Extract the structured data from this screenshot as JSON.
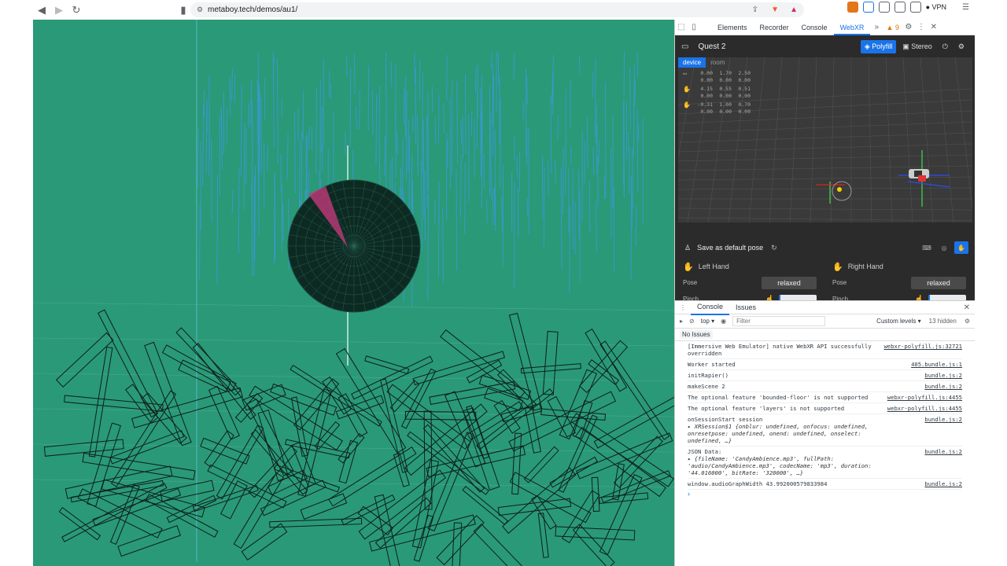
{
  "browser": {
    "url": "metaboy.tech/demos/au1/",
    "vpn_label": "VPN"
  },
  "devtools": {
    "tabs": [
      "Elements",
      "Recorder",
      "Console",
      "WebXR"
    ],
    "active_tab": "WebXR",
    "warning_count": "9"
  },
  "webxr": {
    "device": "Quest 2",
    "polyfill_label": "Polyfill",
    "stereo_label": "Stereo",
    "scene_tabs": [
      "device",
      "room"
    ],
    "poses": [
      {
        "icon": "headset-icon",
        "row1": [
          "0.00",
          "1.70",
          "2.50"
        ],
        "row2": [
          "0.00",
          "0.00",
          "0.00"
        ]
      },
      {
        "icon": "left-hand-icon",
        "row1": [
          "4.15",
          "0.55",
          "0.51"
        ],
        "row2": [
          "0.00",
          "0.00",
          "0.00"
        ]
      },
      {
        "icon": "right-hand-icon",
        "row1": [
          "-0.31",
          "1.00",
          "0.70"
        ],
        "row2": [
          "0.00",
          "0.00",
          "0.00"
        ]
      }
    ],
    "save_pose_label": "Save as default pose",
    "left_hand": {
      "title": "Left Hand",
      "pose_label": "Pose",
      "pose_value": "relaxed",
      "pinch_label": "Pinch",
      "pinch_level": 0.05
    },
    "right_hand": {
      "title": "Right Hand",
      "pose_label": "Pose",
      "pose_value": "relaxed",
      "pinch_label": "Pinch",
      "pinch_level": 0.05
    }
  },
  "console": {
    "tabs": [
      "Console",
      "Issues"
    ],
    "context": "top",
    "filter_placeholder": "Filter",
    "levels": "Custom levels",
    "hidden": "13 hidden",
    "no_issues": "No Issues",
    "entries": [
      {
        "msg": "[Immersive Web Emulator] native WebXR API successfully overridden",
        "src": "webxr-polyfill.js:32721"
      },
      {
        "msg": "Worker started",
        "src": "405.bundle.js:1"
      },
      {
        "msg": "initRapier()",
        "src": "bundle.js:2"
      },
      {
        "msg": "makeScene 2",
        "src": "bundle.js:2"
      },
      {
        "msg": "The optional feature 'bounded-floor' is not supported",
        "src": "webxr-polyfill.js:4455"
      },
      {
        "msg": "The optional feature 'layers' is not supported",
        "src": "webxr-polyfill.js:4455"
      },
      {
        "msg": "onSessionStart session",
        "src": "bundle.js:2",
        "obj": "▸ XRSession$1 {onblur: undefined, onfocus: undefined, onresetpose: undefined, onend: undefined, onselect: undefined, …}"
      },
      {
        "msg": "JSON Data:",
        "src": "bundle.js:2",
        "obj": "▸ {fileName: 'CandyAmbience.mp3', fullPath: 'audio/CandyAmbience.mp3', codecName: 'mp3', duration: '44.016000', bitRate: '320000', …}"
      },
      {
        "msg": "window.audioGraphWidth 43.992000579833984",
        "src": "bundle.js:2"
      }
    ]
  }
}
